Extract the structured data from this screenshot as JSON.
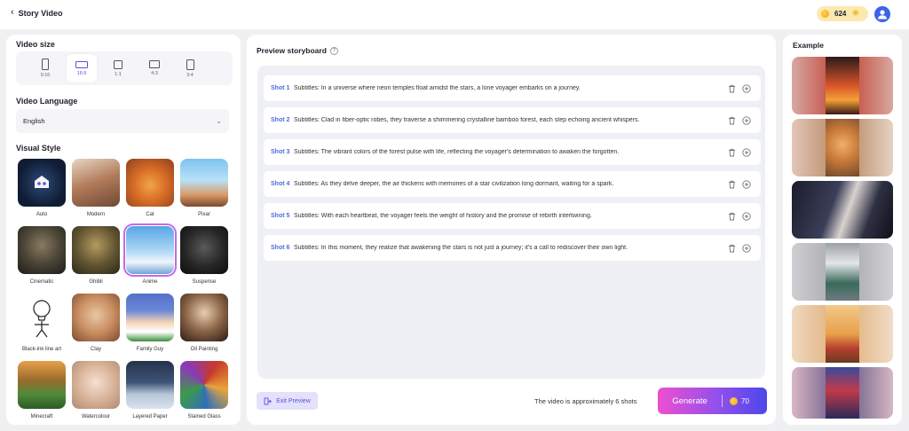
{
  "header": {
    "back_label": "Story Video",
    "coins": "624"
  },
  "video_size": {
    "title": "Video size",
    "options": [
      {
        "label": "9:16",
        "active": false
      },
      {
        "label": "16:9",
        "active": true
      },
      {
        "label": "1:1",
        "active": false
      },
      {
        "label": "4:3",
        "active": false
      },
      {
        "label": "3:4",
        "active": false
      }
    ]
  },
  "language": {
    "title": "Video Language",
    "value": "English"
  },
  "visual_style": {
    "title": "Visual Style",
    "items": [
      {
        "label": "Auto"
      },
      {
        "label": "Modern"
      },
      {
        "label": "Cat"
      },
      {
        "label": "Pixar"
      },
      {
        "label": "Cinematic"
      },
      {
        "label": "Ghibli"
      },
      {
        "label": "Anime",
        "selected": true
      },
      {
        "label": "Suspense"
      },
      {
        "label": "Black-ink line art"
      },
      {
        "label": "Clay"
      },
      {
        "label": "Family Guy"
      },
      {
        "label": "Oil Painting"
      },
      {
        "label": "Minecraft"
      },
      {
        "label": "Watercolour"
      },
      {
        "label": "Layered Paper"
      },
      {
        "label": "Stained Glass"
      }
    ]
  },
  "storyboard": {
    "title": "Preview storyboard",
    "shots": [
      {
        "num": "Shot 1",
        "text": "Subtitles: In a universe where neon temples float amidst the stars, a lone voyager embarks on a journey."
      },
      {
        "num": "Shot 2",
        "text": "Subtitles: Clad in fiber-optic robes, they traverse a shimmering crystalline bamboo forest, each step echoing ancient whispers."
      },
      {
        "num": "Shot 3",
        "text": "Subtitles: The vibrant colors of the forest pulse with life, reflecting the voyager's determination to awaken the forgotten."
      },
      {
        "num": "Shot 4",
        "text": "Subtitles: As they delve deeper, the air thickens with memories of a star civilization long dormant, waiting for a spark."
      },
      {
        "num": "Shot 5",
        "text": "Subtitles: With each heartbeat, the voyager feels the weight of history and the promise of rebirth intertwining."
      },
      {
        "num": "Shot 6",
        "text": "Subtitles: In this moment, they realize that awakening the stars is not just a journey; it's a call to rediscover their own light."
      }
    ],
    "exit_label": "Exit Preview",
    "approx_text": "The video is approximately 6 shots",
    "generate_label": "Generate",
    "generate_cost": "70"
  },
  "example": {
    "title": "Example"
  },
  "colors": {
    "accent": "#5b4fe0",
    "shot_label": "#4b6cd8",
    "selected_outline": "#c36be8"
  }
}
